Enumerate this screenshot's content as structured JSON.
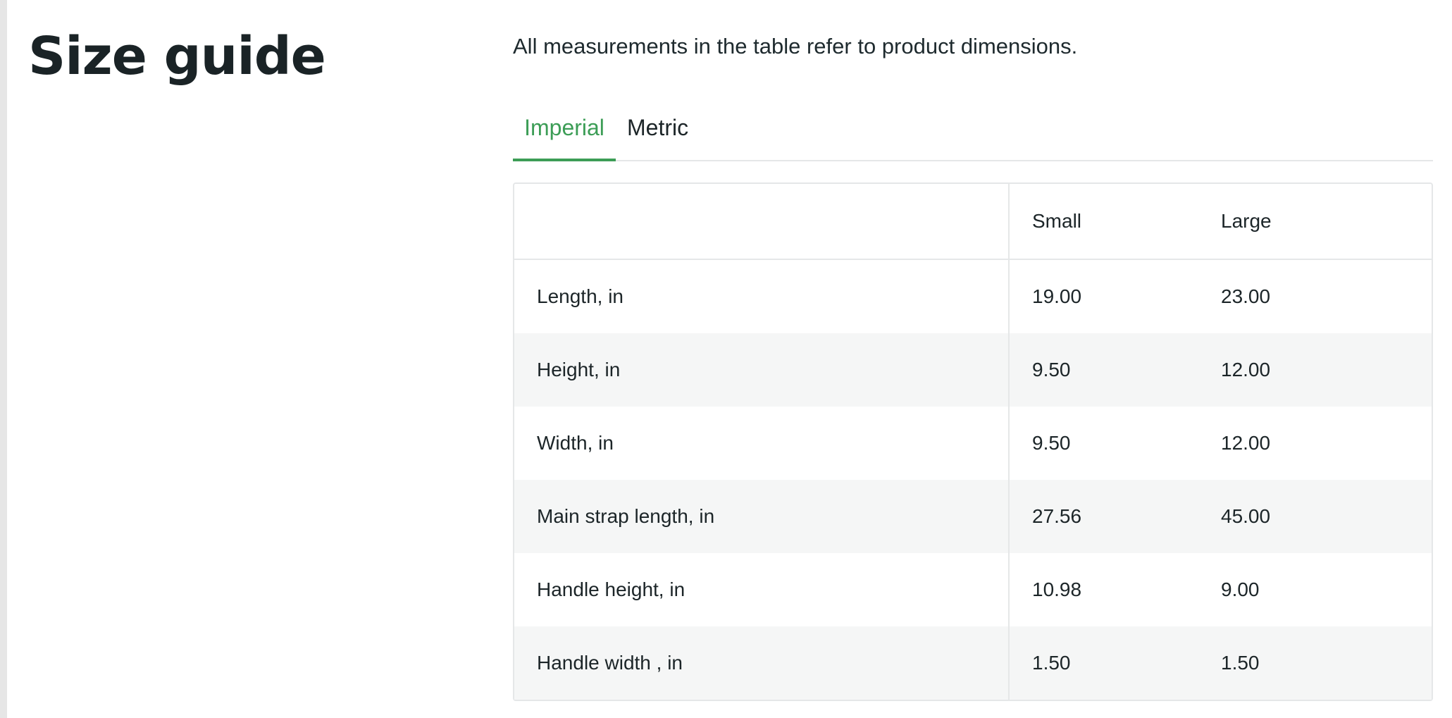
{
  "page": {
    "title": "Size guide",
    "intro": "All measurements in the table refer to product dimensions."
  },
  "tabs": [
    {
      "label": "Imperial",
      "active": true
    },
    {
      "label": "Metric",
      "active": false
    }
  ],
  "colors": {
    "accent": "#3c9d56",
    "text": "#1c2528",
    "row_alt": "#f5f6f6",
    "border": "#e5e7e8"
  },
  "table": {
    "columns": [
      "",
      "Small",
      "Large"
    ],
    "rows": [
      {
        "label": "Length, in",
        "small": "19.00",
        "large": "23.00"
      },
      {
        "label": "Height, in",
        "small": "9.50",
        "large": "12.00"
      },
      {
        "label": "Width, in",
        "small": "9.50",
        "large": "12.00"
      },
      {
        "label": "Main strap length, in",
        "small": "27.56",
        "large": "45.00"
      },
      {
        "label": "Handle height, in",
        "small": "10.98",
        "large": "9.00"
      },
      {
        "label": "Handle width , in",
        "small": "1.50",
        "large": "1.50"
      }
    ]
  }
}
